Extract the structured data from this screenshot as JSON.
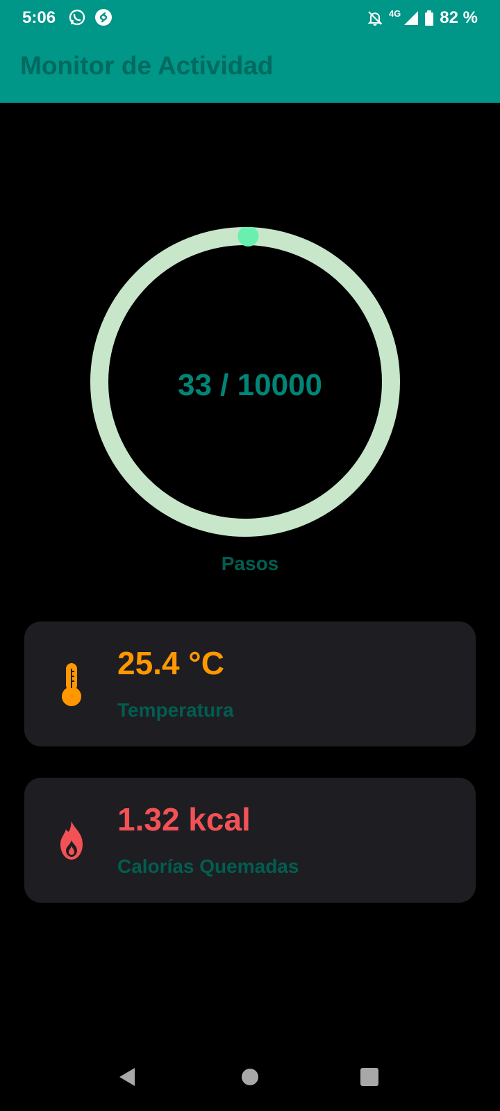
{
  "status_bar": {
    "time": "5:06",
    "apps": [
      "whatsapp-icon",
      "shazam-icon"
    ],
    "network": "4G",
    "battery": "82 %"
  },
  "app_bar": {
    "title": "Monitor de Actividad"
  },
  "steps": {
    "current": 33,
    "goal": 10000,
    "display": "33 / 10000",
    "label": "Pasos",
    "progress_fraction": 0.0033,
    "colors": {
      "track": "#c8e6c9",
      "indicator": "#69f0ae",
      "value": "#008577"
    }
  },
  "cards": [
    {
      "icon": "thermometer-icon",
      "value": "25.4 °C",
      "label": "Temperatura",
      "value_color": "#ff9800"
    },
    {
      "icon": "fire-icon",
      "value": "1.32 kcal",
      "label": "Calorías Quemadas",
      "value_color": "#f25255"
    }
  ],
  "nav": {
    "buttons": [
      "back-icon",
      "home-icon",
      "recents-icon"
    ]
  },
  "colors": {
    "primary": "#009688",
    "title_text": "#006a5f",
    "background": "#000000",
    "card": "#1e1d22",
    "label": "#005e50"
  }
}
